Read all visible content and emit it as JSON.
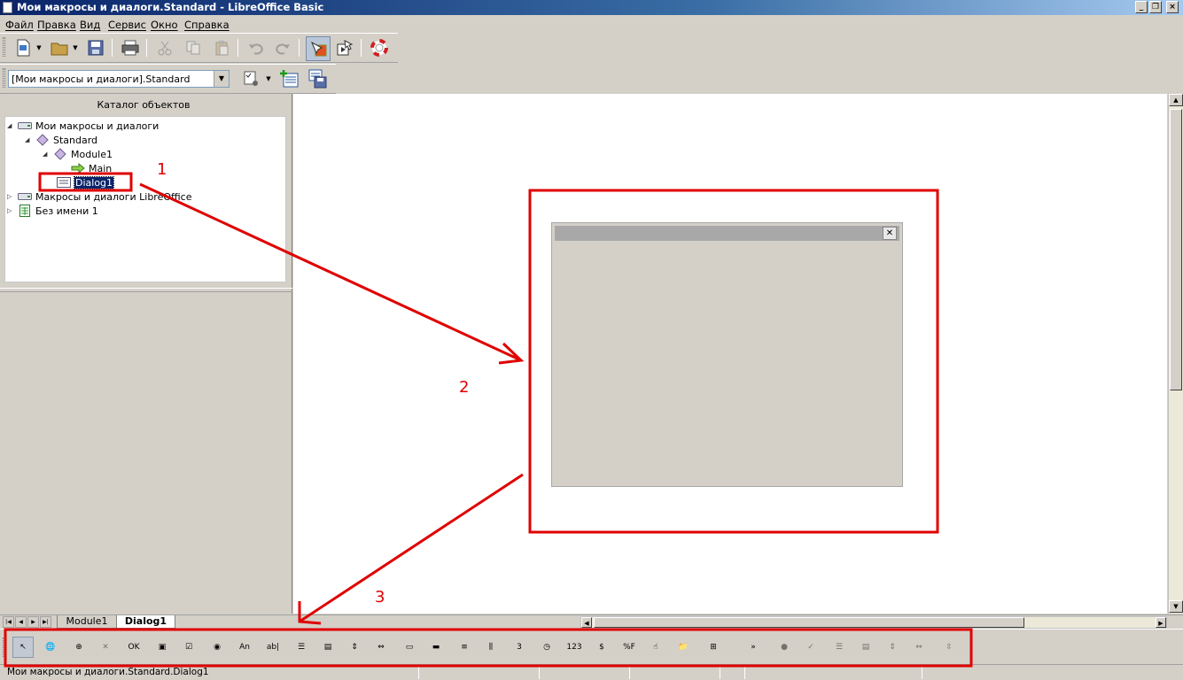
{
  "window": {
    "title": "Мои макросы и диалоги.Standard - LibreOffice Basic",
    "controls": {
      "minimize": "_",
      "restore": "❐",
      "close": "×"
    }
  },
  "menu": [
    "Файл",
    "Правка",
    "Вид",
    "Сервис",
    "Окно",
    "Справка"
  ],
  "toolbar_standard": {
    "icons": [
      "new-document-icon",
      "open-folder-icon",
      "save-icon",
      "print-icon",
      "cut-icon",
      "copy-icon",
      "paste-icon",
      "undo-icon",
      "redo-icon",
      "design-mode-icon",
      "run-control-icon",
      "help-icon"
    ]
  },
  "library_bar": {
    "library_value": "[Мои макросы и диалоги].Standard",
    "icons": [
      "select-module-icon",
      "insert-module-icon",
      "save-basic-icon"
    ]
  },
  "catalog": {
    "title": "Каталог объектов",
    "tree": [
      {
        "label": "Мои макросы и диалоги",
        "level": 0,
        "expanded": true,
        "icon": "drive-icon"
      },
      {
        "label": "Standard",
        "level": 1,
        "expanded": true,
        "icon": "library-diamond-icon"
      },
      {
        "label": "Module1",
        "level": 2,
        "expanded": true,
        "icon": "module-diamond-icon"
      },
      {
        "label": "Main",
        "level": 3,
        "expanded": false,
        "icon": "macro-arrow-icon"
      },
      {
        "label": "Dialog1",
        "level": 2,
        "expanded": false,
        "icon": "dialog-icon",
        "selected": true
      },
      {
        "label": "Макросы и диалоги LibreOffice",
        "level": 0,
        "expanded": false,
        "icon": "drive-icon"
      },
      {
        "label": "Без имени 1",
        "level": 0,
        "expanded": false,
        "icon": "spreadsheet-icon"
      }
    ]
  },
  "tabs": [
    {
      "label": "Module1",
      "active": false
    },
    {
      "label": "Dialog1",
      "active": true
    }
  ],
  "controls_toolbar": {
    "overflow": "»",
    "items": [
      {
        "name": "select-icon",
        "glyph": "↖",
        "pressed": true
      },
      {
        "name": "language-icon",
        "glyph": "🌐"
      },
      {
        "name": "test-mode-icon",
        "glyph": "⊕"
      },
      {
        "name": "control-properties-icon",
        "glyph": "✕",
        "disabled": true
      },
      {
        "name": "push-button-icon",
        "glyph": "OK"
      },
      {
        "name": "image-control-icon",
        "glyph": "▣"
      },
      {
        "name": "checkbox-icon",
        "glyph": "☑"
      },
      {
        "name": "option-button-icon",
        "glyph": "◉"
      },
      {
        "name": "label-icon",
        "glyph": "An"
      },
      {
        "name": "text-box-icon",
        "glyph": "ab|"
      },
      {
        "name": "list-box-icon",
        "glyph": "☰"
      },
      {
        "name": "combo-box-icon",
        "glyph": "▤"
      },
      {
        "name": "vertical-scrollbar-icon",
        "glyph": "⇕"
      },
      {
        "name": "horizontal-scrollbar-icon",
        "glyph": "⇔"
      },
      {
        "name": "group-box-icon",
        "glyph": "▭"
      },
      {
        "name": "progress-bar-icon",
        "glyph": "▬"
      },
      {
        "name": "horizontal-line-icon",
        "glyph": "≡"
      },
      {
        "name": "vertical-line-icon",
        "glyph": "⫼"
      },
      {
        "name": "date-field-icon",
        "glyph": "3"
      },
      {
        "name": "time-field-icon",
        "glyph": "◷"
      },
      {
        "name": "numeric-field-icon",
        "glyph": "123"
      },
      {
        "name": "currency-field-icon",
        "glyph": "$"
      },
      {
        "name": "formatted-field-icon",
        "glyph": "%F"
      },
      {
        "name": "pattern-field-icon",
        "glyph": "☝"
      },
      {
        "name": "file-selection-icon",
        "glyph": "📁"
      },
      {
        "name": "tree-control-icon",
        "glyph": "⊞"
      },
      {
        "name": "overflow-chevron-icon",
        "glyph": "»"
      },
      {
        "name": "option-button-disabled-icon",
        "glyph": "●",
        "disabled": true
      },
      {
        "name": "checkbox-disabled-icon",
        "glyph": "✓",
        "disabled": true
      },
      {
        "name": "list-box-disabled-icon",
        "glyph": "☰",
        "disabled": true
      },
      {
        "name": "combo-box-disabled-icon",
        "glyph": "▤",
        "disabled": true
      },
      {
        "name": "vertical-scrollbar-disabled-icon",
        "glyph": "⇕",
        "disabled": true
      },
      {
        "name": "horizontal-scrollbar-disabled-icon",
        "glyph": "⇔",
        "disabled": true
      },
      {
        "name": "spin-button-disabled-icon",
        "glyph": "⇳",
        "disabled": true
      }
    ]
  },
  "dialog_preview": {
    "close_glyph": "✕"
  },
  "status": {
    "text": "Мои макросы и диалоги.Standard.Dialog1"
  },
  "annotations": {
    "labels": [
      "1",
      "2",
      "3"
    ],
    "color": "#e00000"
  },
  "colors": {
    "title_bar": "#0a246a",
    "selection": "#0a246a",
    "annotation": "#e00000",
    "chrome": "#d4d0c8"
  }
}
